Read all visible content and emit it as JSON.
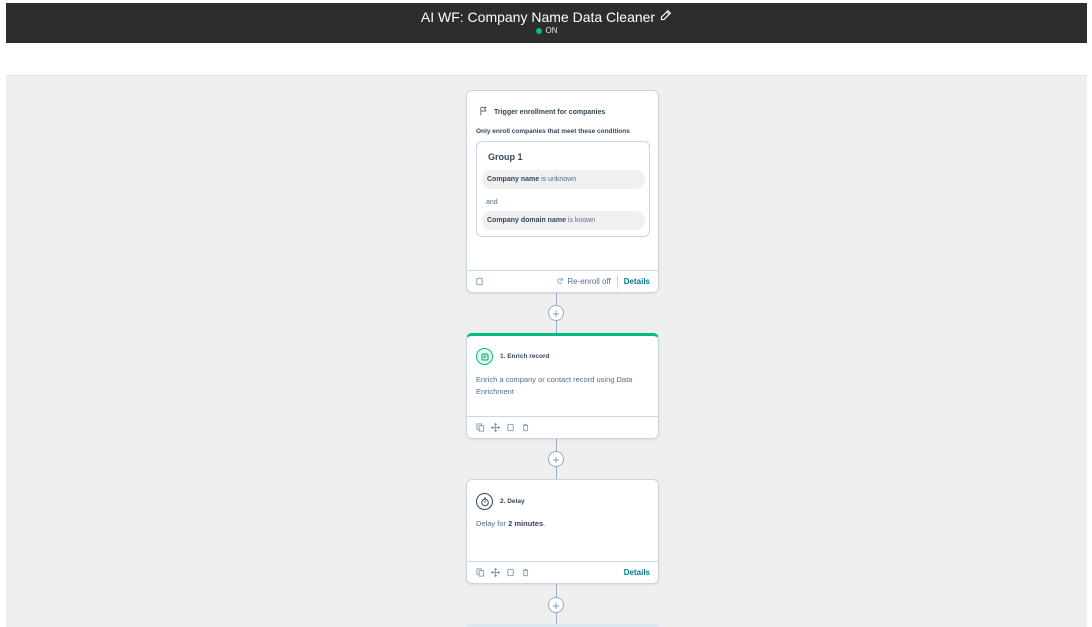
{
  "header": {
    "title": "AI WF: Company Name Data Cleaner",
    "status": "ON",
    "colors": {
      "bar": "#2d2d2d",
      "status_dot": "#00bd7e"
    }
  },
  "trigger": {
    "heading": "Trigger enrollment for companies",
    "subheading": "Only enroll companies that meet these conditions",
    "group_title": "Group 1",
    "conditions": [
      {
        "property": "Company name",
        "operator": "is unknown"
      },
      {
        "property": "Company domain name",
        "operator": "is known"
      }
    ],
    "joiner": "and",
    "reenroll": "Re-enroll off",
    "details": "Details"
  },
  "actions": [
    {
      "title": "1. Enrich record",
      "description": "Enrich a company or contact record using Data Enrichment",
      "icon": "enrich-icon",
      "accent": "#00bd7e"
    },
    {
      "title": "2. Delay",
      "desc_prefix": "Delay for ",
      "desc_bold": "2 minutes",
      "desc_suffix": ".",
      "icon": "stopwatch-icon",
      "details": "Details"
    }
  ]
}
